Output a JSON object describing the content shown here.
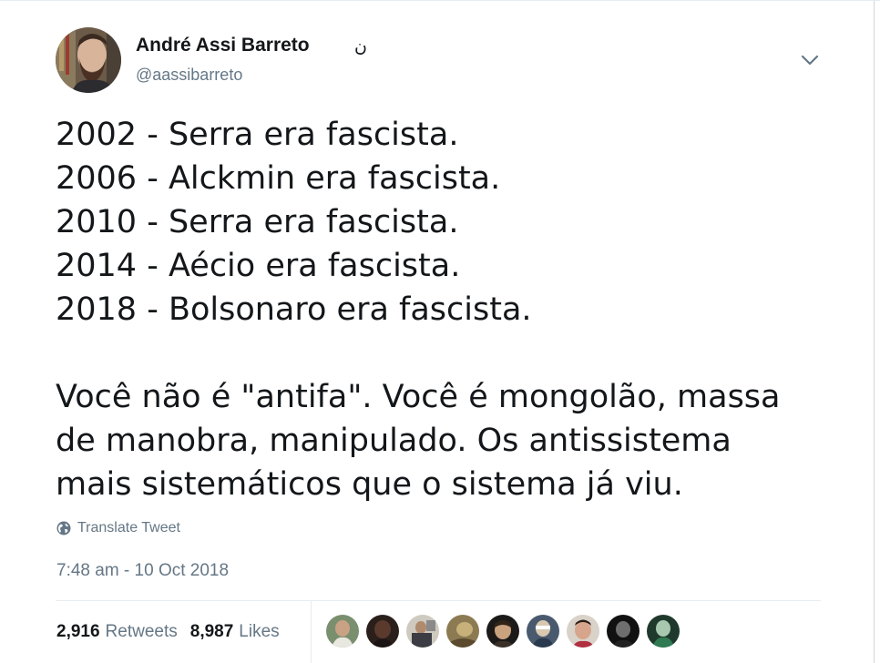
{
  "author": {
    "display_name": "André Assi Barreto",
    "name_glyph": "ن",
    "handle": "@aassibarreto"
  },
  "tweet": {
    "lines": [
      "2002 - Serra era fascista.",
      "2006 - Alckmin era fascista.",
      "2010 - Serra era fascista.",
      "2014 - Aécio era fascista.",
      "2018 - Bolsonaro era fascista."
    ],
    "paragraph_lines": [
      "Você não é \"antifa\". Você é mongolão, massa",
      "de manobra, manipulado. Os antissistema",
      "mais sistemáticos que o sistema já viu."
    ]
  },
  "translate_label": "Translate Tweet",
  "timestamp": "7:48 am - 10 Oct 2018",
  "stats": {
    "retweets_count": "2,916",
    "retweets_label": "Retweets",
    "likes_count": "8,987",
    "likes_label": "Likes"
  },
  "icons": {
    "caret": "chevron-down-icon",
    "translate": "globe-icon"
  },
  "colors": {
    "text": "#14171a",
    "secondary": "#657786",
    "divider": "#e6ecf0"
  }
}
